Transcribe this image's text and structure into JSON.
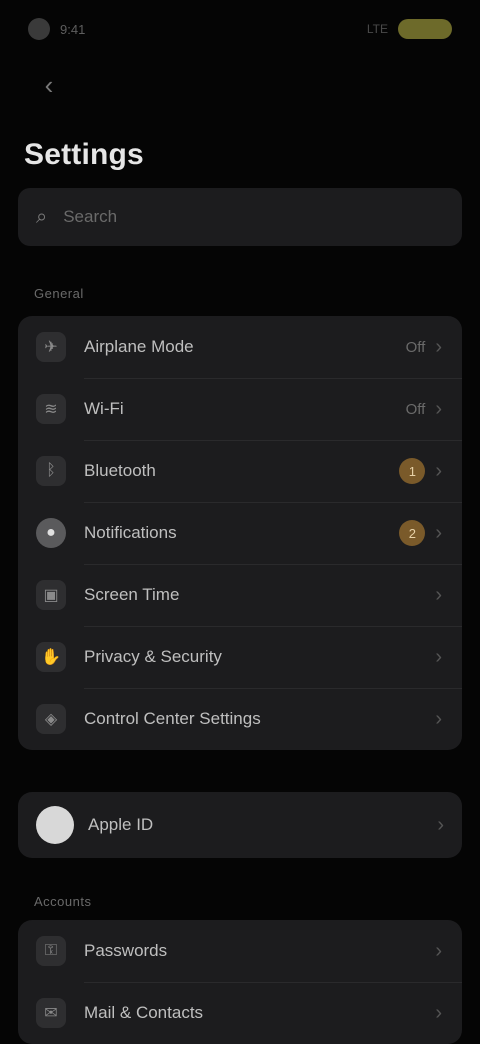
{
  "status_bar": {
    "time": "9:41",
    "carrier": "LTE",
    "battery": "100%"
  },
  "header": {
    "back_icon": "chevron-left-icon",
    "title": "Settings"
  },
  "search": {
    "placeholder": "Search"
  },
  "section1": {
    "label": "General",
    "items": [
      {
        "icon": "airplane-icon",
        "label": "Airplane Mode",
        "value": "Off",
        "badge": ""
      },
      {
        "icon": "wifi-icon",
        "label": "Wi-Fi",
        "value": "Off",
        "badge": ""
      },
      {
        "icon": "bluetooth-icon",
        "label": "Bluetooth",
        "value": "",
        "badge": "1"
      },
      {
        "icon": "bell-icon",
        "label": "Notifications",
        "value": "",
        "badge": "2"
      },
      {
        "icon": "lock-icon",
        "label": "Screen Time",
        "value": "",
        "badge": ""
      },
      {
        "icon": "hand-icon",
        "label": "Privacy & Security",
        "value": "",
        "badge": ""
      },
      {
        "icon": "shield-icon",
        "label": "Control Center Settings",
        "value": "",
        "badge": ""
      }
    ]
  },
  "profile": {
    "name": "Apple ID"
  },
  "section2": {
    "label": "Accounts",
    "items": [
      {
        "icon": "key-icon",
        "label": "Passwords"
      },
      {
        "icon": "mail-icon",
        "label": "Mail & Contacts"
      }
    ]
  }
}
